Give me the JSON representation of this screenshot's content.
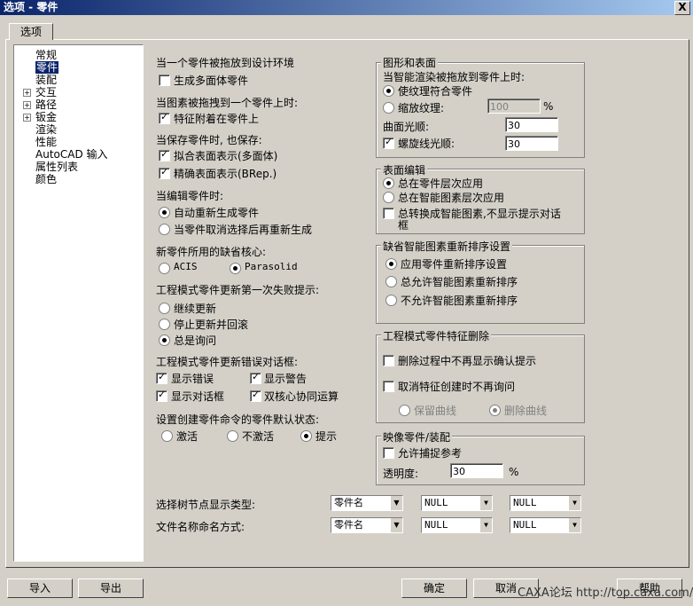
{
  "window": {
    "title": "选项 - 零件",
    "close": "X"
  },
  "tab": "选项",
  "tree": [
    {
      "label": "常规",
      "expand": false
    },
    {
      "label": "零件",
      "expand": false,
      "selected": true
    },
    {
      "label": "装配",
      "expand": false
    },
    {
      "label": "交互",
      "expand": true
    },
    {
      "label": "路径",
      "expand": true
    },
    {
      "label": "钣金",
      "expand": true
    },
    {
      "label": "渲染",
      "expand": false
    },
    {
      "label": "性能",
      "expand": false
    },
    {
      "label": "AutoCAD 输入",
      "expand": false
    },
    {
      "label": "属性列表",
      "expand": false
    },
    {
      "label": "颜色",
      "expand": false
    }
  ],
  "left": {
    "drag_design": {
      "label": "当一个零件被拖放到设计环境",
      "opt": "生成多面体零件",
      "checked": false
    },
    "drag_element": {
      "label": "当图素被拖拽到一个零件上时:",
      "opt": "特征附着在零件上",
      "checked": true
    },
    "save": {
      "label": "当保存零件时, 也保存:",
      "opt1": "拟合表面表示(多面体)",
      "opt2": "精确表面表示(BRep.)"
    },
    "edit": {
      "label": "当编辑零件时:",
      "opt1": "自动重新生成零件",
      "opt2": "当零件取消选择后再重新生成"
    },
    "kernel": {
      "label": "新零件所用的缺省核心:",
      "opt1": "ACIS",
      "opt2": "Parasolid"
    },
    "fail": {
      "label": "工程模式零件更新第一次失败提示:",
      "opt1": "继续更新",
      "opt2": "停止更新并回滚",
      "opt3": "总是询问"
    },
    "errdlg": {
      "label": "工程模式零件更新错误对话框:",
      "opt1": "显示错误",
      "opt2": "显示警告",
      "opt3": "显示对话框",
      "opt4": "双核心协同运算"
    },
    "default_state": {
      "label": "设置创建零件命令的零件默认状态:",
      "opt1": "激活",
      "opt2": "不激活",
      "opt3": "提示"
    }
  },
  "right": {
    "graphics": {
      "title": "图形和表面",
      "sub": "当智能渲染被拖放到零件上时:",
      "opt1": "使纹理符合零件",
      "opt2": "缩放纹理:",
      "scale": "100",
      "pct": "%",
      "smooth_label": "曲面光顺:",
      "smooth": "30",
      "spiral_label": "螺旋线光顺:",
      "spiral": "30"
    },
    "surface": {
      "title": "表面编辑",
      "opt1": "总在零件层次应用",
      "opt2": "总在智能图素层次应用",
      "opt3a": "总转换成智能图素,不显示提示对话",
      "opt3b": "框"
    },
    "reorder": {
      "title": "缺省智能图素重新排序设置",
      "opt1": "应用零件重新排序设置",
      "opt2": "总允许智能图素重新排序",
      "opt3": "不允许智能图素重新排序"
    },
    "delete": {
      "title": "工程模式零件特征删除",
      "opt1": "删除过程中不再显示确认提示",
      "opt2": "取消特征创建时不再询问",
      "keep": "保留曲线",
      "del": "删除曲线"
    },
    "mirror": {
      "title": "映像零件/装配",
      "opt": "允许捕捉参考",
      "trans_label": "透明度:",
      "trans": "30",
      "pct": "%"
    }
  },
  "bottom": {
    "tree_type": {
      "label": "选择树节点显示类型:",
      "s1": "零件名",
      "s2": "NULL",
      "s3": "NULL"
    },
    "file_name": {
      "label": "文件名称命名方式:",
      "s1": "零件名",
      "s2": "NULL",
      "s3": "NULL"
    }
  },
  "buttons": {
    "import": "导入",
    "export": "导出",
    "ok": "确定",
    "cancel": "取消",
    "help": "帮助"
  },
  "watermark": "CAXA论坛 http://top.caxa.com/"
}
